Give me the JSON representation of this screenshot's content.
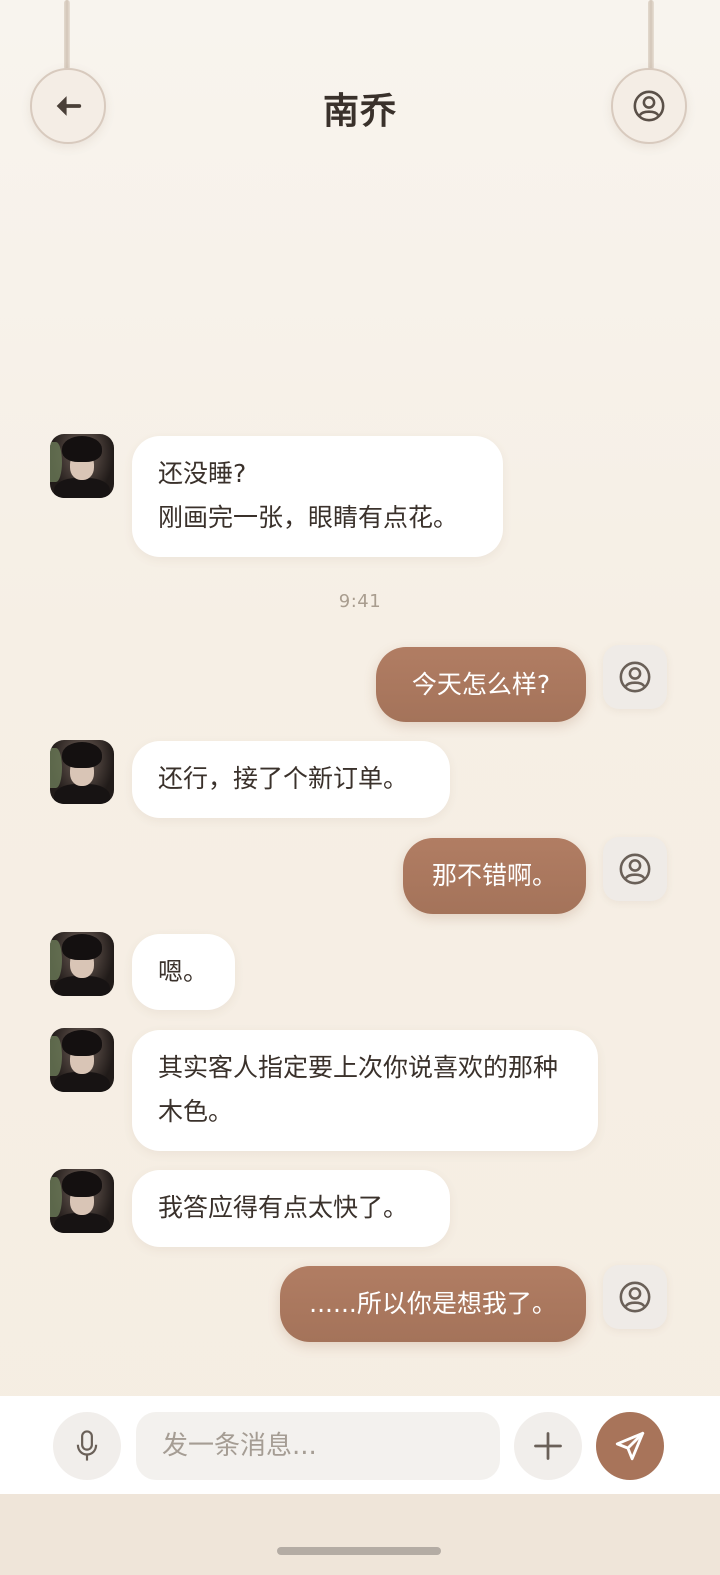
{
  "header": {
    "title": "南乔",
    "back_icon": "arrow-left-icon",
    "profile_icon": "user-circle-icon"
  },
  "messages": [
    {
      "side": "in",
      "lines": [
        "还没睡?",
        "刚画完一张，眼睛有点花。"
      ]
    },
    {
      "timestamp": "9:41"
    },
    {
      "side": "out",
      "text": "今天怎么样?"
    },
    {
      "side": "in",
      "text": "还行，接了个新订单。"
    },
    {
      "side": "out",
      "text": "那不错啊。"
    },
    {
      "side": "in",
      "text": "嗯。"
    },
    {
      "side": "in",
      "text": "其实客人指定要上次你说喜欢的那种木色。"
    },
    {
      "side": "in",
      "text": "我答应得有点太快了。"
    },
    {
      "side": "out",
      "text": "......所以你是想我了。"
    }
  ],
  "input": {
    "placeholder": "发一条消息...",
    "value": "",
    "mic_icon": "microphone-icon",
    "plus_icon": "plus-icon",
    "send_icon": "send-icon"
  },
  "colors": {
    "accent": "#a8745a",
    "outgoing_bubble": "#ad7a60",
    "incoming_bubble": "#ffffff",
    "background": "#f6efe5"
  }
}
